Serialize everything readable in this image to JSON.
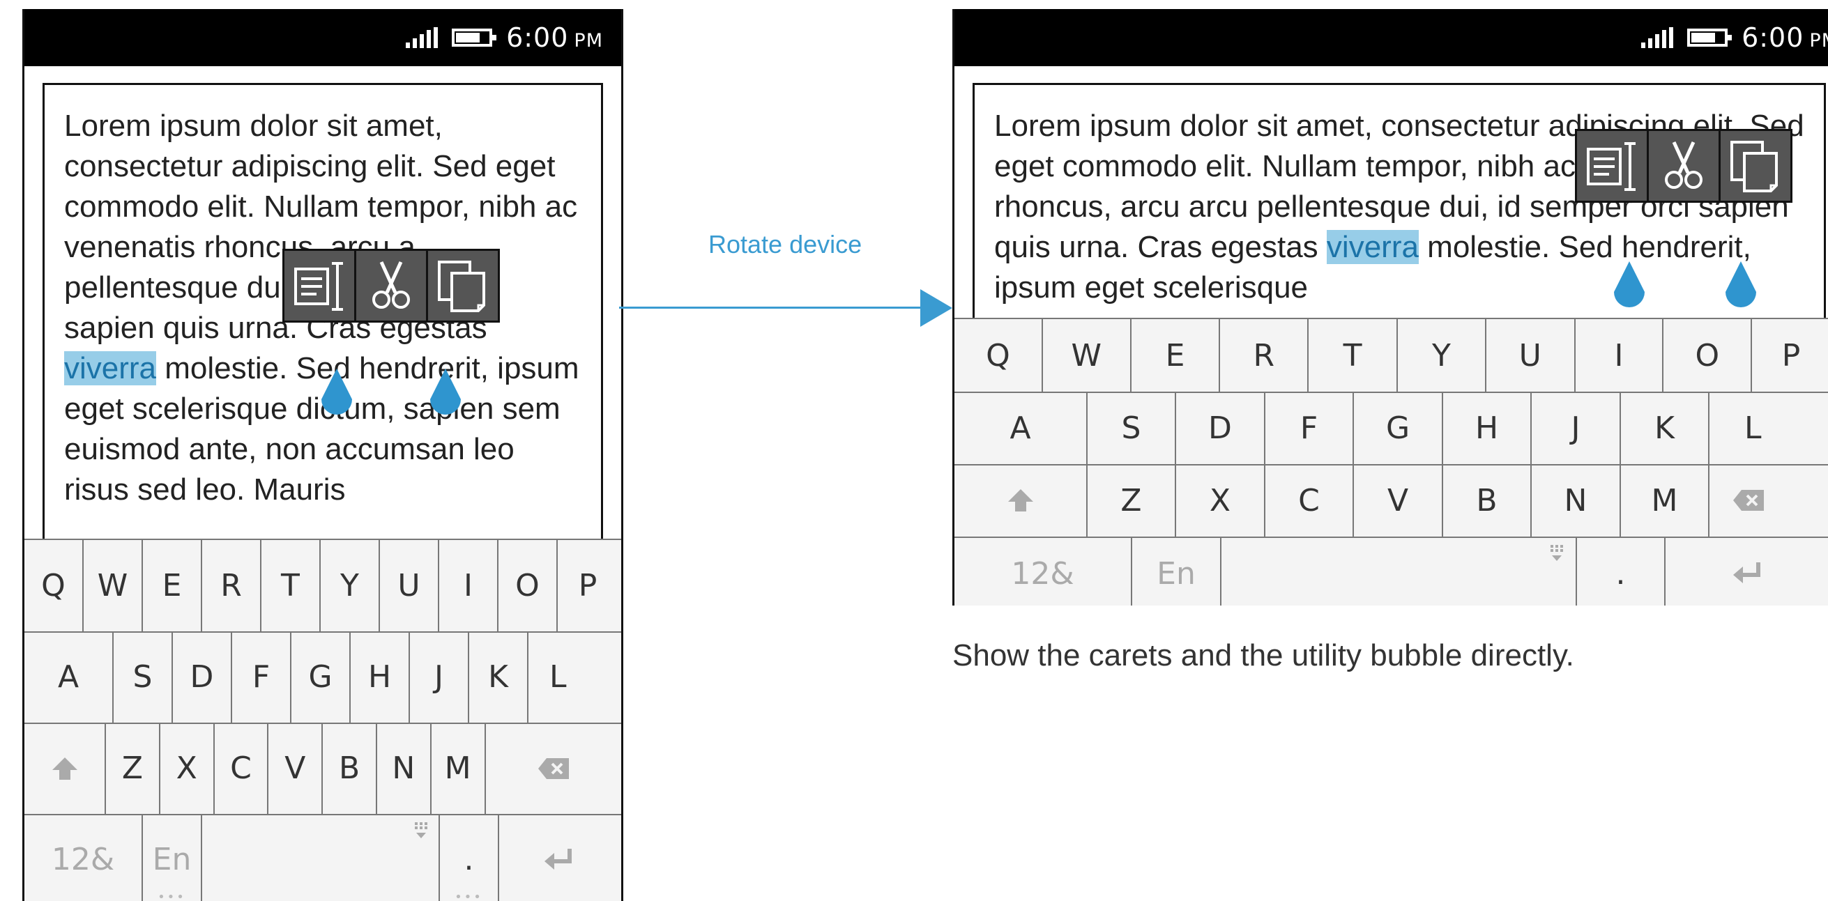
{
  "status_bar": {
    "time": "6:00",
    "ampm": "PM"
  },
  "screen_a": {
    "text_before": "Lorem ipsum dolor sit amet, consectetur adipiscing elit. Sed eget commodo elit. Nullam tempor, nibh ac venenatis rhoncus, arcu a pellentesque dui, id semper orci sapien quis urna. Cras egestas ",
    "selected_word": "viverra",
    "text_after": " molestie. Sed hendrerit, ipsum eget scelerisque dictum, sapien sem euismod ante, non accumsan leo risus sed leo. Mauris"
  },
  "screen_b": {
    "text_before": "Lorem ipsum dolor sit amet, consectetur adipiscing elit. Sed eget commodo elit. Nullam tempor, nibh ac venenatis rhoncus, arcu arcu pellentesque dui, id semper orci sapien quis urna. Cras egestas ",
    "selected_word": "viverra",
    "text_after": " molestie. Sed hendrerit, ipsum eget scelerisque"
  },
  "bubble_icons": [
    "select-all-icon",
    "cut-icon",
    "copy-icon"
  ],
  "keyboard": {
    "row1": [
      "Q",
      "W",
      "E",
      "R",
      "T",
      "Y",
      "U",
      "I",
      "O",
      "P"
    ],
    "row2": [
      "A",
      "S",
      "D",
      "F",
      "G",
      "H",
      "J",
      "K",
      "L"
    ],
    "row3": [
      "Z",
      "X",
      "C",
      "V",
      "B",
      "N",
      "M"
    ],
    "numbers_label": "12&",
    "lang_label": "En",
    "period_label": "."
  },
  "flow": {
    "label": "Rotate device"
  },
  "caption": "Show the carets and the utility bubble directly.",
  "colors": {
    "accent": "#3a9bd1",
    "selection": "#97cde8",
    "caret": "#2f95cf",
    "bubble": "#555555"
  }
}
